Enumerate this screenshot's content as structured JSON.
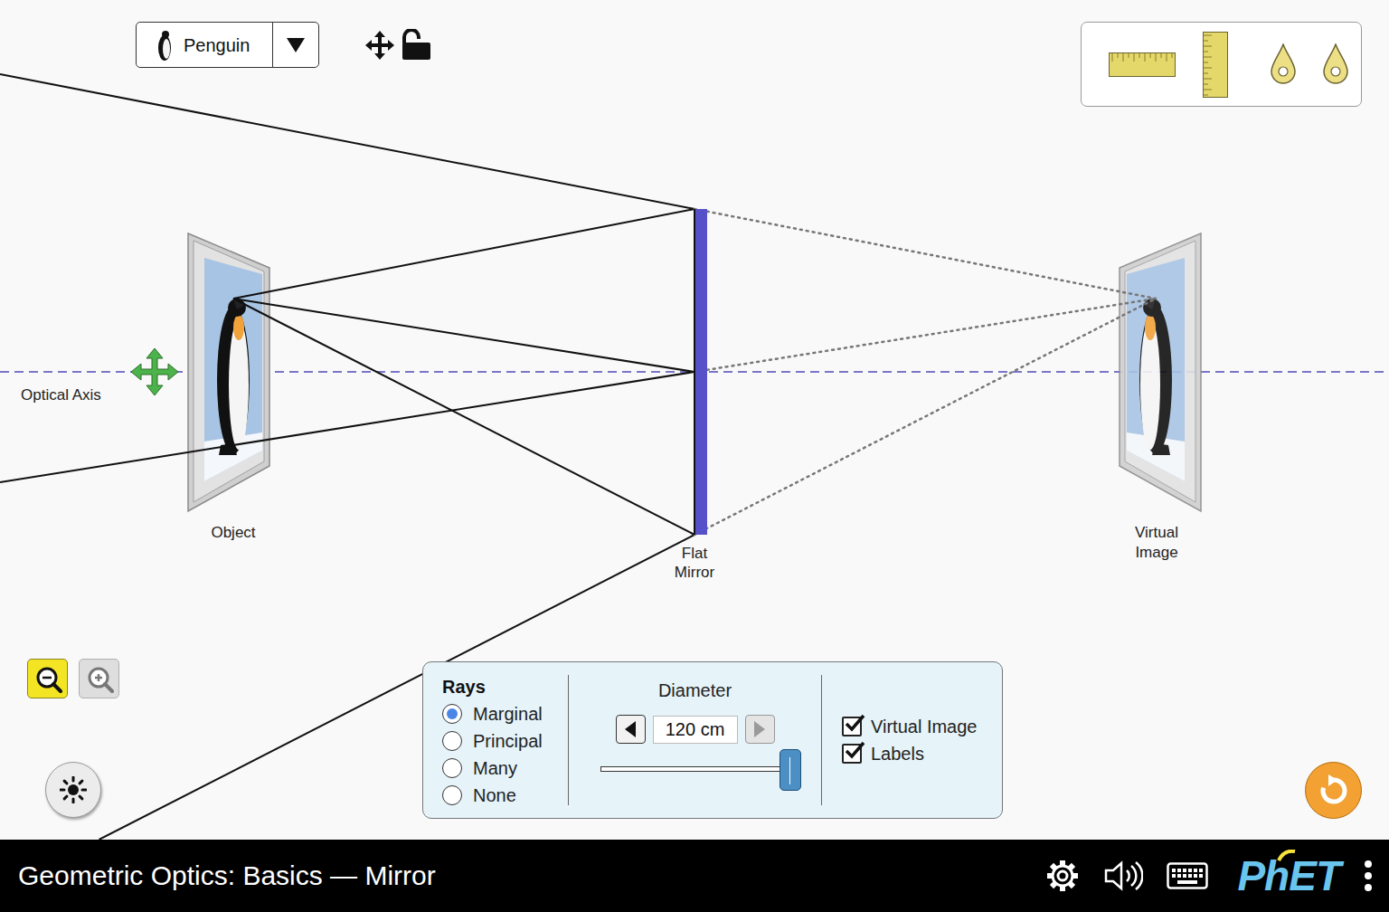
{
  "object_selector": {
    "label": "Penguin"
  },
  "position_locked": false,
  "labels_text": {
    "optical_axis": "Optical Axis",
    "object": "Object",
    "mirror": [
      "Flat",
      "Mirror"
    ],
    "virtual_image": [
      "Virtual",
      "Image"
    ]
  },
  "zoom": {
    "out_enabled": true,
    "in_enabled": false
  },
  "rays": {
    "title": "Rays",
    "options": [
      {
        "label": "Marginal",
        "selected": true
      },
      {
        "label": "Principal",
        "selected": false
      },
      {
        "label": "Many",
        "selected": false
      },
      {
        "label": "None",
        "selected": false
      }
    ]
  },
  "diameter": {
    "title": "Diameter",
    "value": "120 cm",
    "level": 1,
    "decrease_enabled": true,
    "increase_enabled": false
  },
  "checkboxes": [
    {
      "label": "Virtual Image",
      "checked": true
    },
    {
      "label": "Labels",
      "checked": true
    }
  ],
  "footer": {
    "title": "Geometric Optics: Basics — Mirror",
    "logo": "PhET"
  }
}
